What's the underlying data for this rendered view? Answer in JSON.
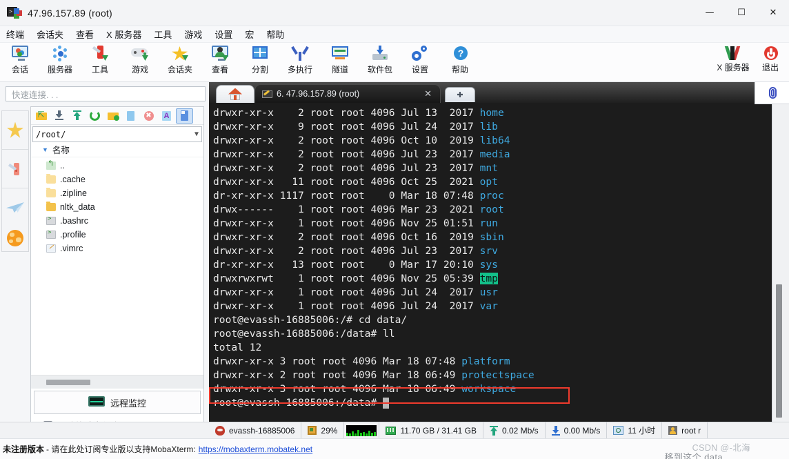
{
  "window": {
    "title": "47.96.157.89 (root)",
    "icon": "mobaxterm-icon",
    "controls": {
      "minimize": "—",
      "maximize": "☐",
      "close": "✕"
    }
  },
  "menubar": [
    {
      "label": "终端",
      "name": "menu-terminal"
    },
    {
      "label": "会话夹",
      "name": "menu-sessions-folder"
    },
    {
      "label": "查看",
      "name": "menu-view"
    },
    {
      "label": "X 服务器",
      "name": "menu-xserver"
    },
    {
      "label": "工具",
      "name": "menu-tools"
    },
    {
      "label": "游戏",
      "name": "menu-games"
    },
    {
      "label": "设置",
      "name": "menu-settings"
    },
    {
      "label": "宏",
      "name": "menu-macros"
    },
    {
      "label": "帮助",
      "name": "menu-help"
    }
  ],
  "toolbar": {
    "items": [
      {
        "label": "会话",
        "icon": "session-icon"
      },
      {
        "label": "服务器",
        "icon": "servers-icon"
      },
      {
        "label": "工具",
        "icon": "tools-icon"
      },
      {
        "label": "游戏",
        "icon": "games-icon"
      },
      {
        "label": "会话夹",
        "icon": "sessions-folder-icon"
      },
      {
        "label": "查看",
        "icon": "view-icon"
      },
      {
        "label": "分割",
        "icon": "split-icon"
      },
      {
        "label": "多执行",
        "icon": "multiexec-icon"
      },
      {
        "label": "隧道",
        "icon": "tunneling-icon"
      },
      {
        "label": "软件包",
        "icon": "packages-icon"
      },
      {
        "label": "设置",
        "icon": "settings-gear-icon"
      },
      {
        "label": "帮助",
        "icon": "help-icon"
      }
    ],
    "right_items": [
      {
        "label": "X 服务器",
        "icon": "xserver-icon"
      },
      {
        "label": "退出",
        "icon": "exit-icon"
      }
    ]
  },
  "quick_connect": {
    "placeholder": "快速连接. . ."
  },
  "rail": [
    {
      "name": "favorites",
      "icon": "star-icon"
    },
    {
      "name": "tools",
      "icon": "swiss-knife-icon"
    },
    {
      "name": "sftp",
      "icon": "paper-plane-icon"
    },
    {
      "name": "web",
      "icon": "globe-icon"
    }
  ],
  "file_browser": {
    "toolbar_icons": [
      "parent-folder-icon",
      "download-icon",
      "upload-icon",
      "refresh-icon",
      "new-folder-icon",
      "new-file-icon",
      "delete-icon",
      "text-format-icon",
      "sftp-mode-icon"
    ],
    "path": "/root/",
    "column_header": "名称",
    "sort_indicator": "▼",
    "entries": [
      {
        "name": "..",
        "type": "updir"
      },
      {
        "name": ".cache",
        "type": "folder-pale"
      },
      {
        "name": ".zipline",
        "type": "folder-pale"
      },
      {
        "name": "nltk_data",
        "type": "folder"
      },
      {
        "name": ".bashrc",
        "type": "shell-file"
      },
      {
        "name": ".profile",
        "type": "shell-file"
      },
      {
        "name": ".vimrc",
        "type": "text-file"
      }
    ],
    "monitor_button": "远程监控",
    "follow_checkbox": "跟踪终端文件夹",
    "follow_checked": false
  },
  "tabs": {
    "home_icon": "home-icon",
    "active": {
      "label": "6. 47.96.157.89 (root)",
      "icon": "key-icon",
      "close": "✕"
    },
    "new_tab": "✚"
  },
  "terminal": {
    "lines": [
      {
        "segments": [
          {
            "t": "drwxr-xr-x    2 root root 4096 Jul 13  2017 "
          },
          {
            "t": "home",
            "c": "dir"
          }
        ]
      },
      {
        "segments": [
          {
            "t": "drwxr-xr-x    9 root root 4096 Jul 24  2017 "
          },
          {
            "t": "lib",
            "c": "dir"
          }
        ]
      },
      {
        "segments": [
          {
            "t": "drwxr-xr-x    2 root root 4096 Oct 10  2019 "
          },
          {
            "t": "lib64",
            "c": "dir"
          }
        ]
      },
      {
        "segments": [
          {
            "t": "drwxr-xr-x    2 root root 4096 Jul 23  2017 "
          },
          {
            "t": "media",
            "c": "dir"
          }
        ]
      },
      {
        "segments": [
          {
            "t": "drwxr-xr-x    2 root root 4096 Jul 23  2017 "
          },
          {
            "t": "mnt",
            "c": "dir"
          }
        ]
      },
      {
        "segments": [
          {
            "t": "drwxr-xr-x   11 root root 4096 Oct 25  2021 "
          },
          {
            "t": "opt",
            "c": "dir"
          }
        ]
      },
      {
        "segments": [
          {
            "t": "dr-xr-xr-x 1117 root root    0 Mar 18 07:48 "
          },
          {
            "t": "proc",
            "c": "dir"
          }
        ]
      },
      {
        "segments": [
          {
            "t": "drwx------    1 root root 4096 Mar 23  2021 "
          },
          {
            "t": "root",
            "c": "dir"
          }
        ]
      },
      {
        "segments": [
          {
            "t": "drwxr-xr-x    1 root root 4096 Nov 25 01:51 "
          },
          {
            "t": "run",
            "c": "dir"
          }
        ]
      },
      {
        "segments": [
          {
            "t": "drwxr-xr-x    2 root root 4096 Oct 16  2019 "
          },
          {
            "t": "sbin",
            "c": "dir"
          }
        ]
      },
      {
        "segments": [
          {
            "t": "drwxr-xr-x    2 root root 4096 Jul 23  2017 "
          },
          {
            "t": "srv",
            "c": "dir"
          }
        ]
      },
      {
        "segments": [
          {
            "t": "dr-xr-xr-x   13 root root    0 Mar 17 20:10 "
          },
          {
            "t": "sys",
            "c": "dir"
          }
        ]
      },
      {
        "segments": [
          {
            "t": "drwxrwxrwt    1 root root 4096 Nov 25 05:39 "
          },
          {
            "t": "tmp",
            "c": "tmp"
          }
        ]
      },
      {
        "segments": [
          {
            "t": "drwxr-xr-x    1 root root 4096 Jul 24  2017 "
          },
          {
            "t": "usr",
            "c": "dir"
          }
        ]
      },
      {
        "segments": [
          {
            "t": "drwxr-xr-x    1 root root 4096 Jul 24  2017 "
          },
          {
            "t": "var",
            "c": "dir"
          }
        ]
      },
      {
        "segments": [
          {
            "t": "root@evassh-16885006:/# cd data/"
          }
        ]
      },
      {
        "segments": [
          {
            "t": "root@evassh-16885006:/data# ll"
          }
        ]
      },
      {
        "segments": [
          {
            "t": "total 12"
          }
        ]
      },
      {
        "segments": [
          {
            "t": "drwxr-xr-x 3 root root 4096 Mar 18 07:48 "
          },
          {
            "t": "platform",
            "c": "dir"
          }
        ]
      },
      {
        "segments": [
          {
            "t": "drwxr-xr-x 2 root root 4096 Mar 18 06:49 "
          },
          {
            "t": "protectspace",
            "c": "dir"
          }
        ]
      },
      {
        "segments": [
          {
            "t": "drwxr-xr-x 3 root root 4096 Mar 18 06:49 "
          },
          {
            "t": "workspace",
            "c": "dir"
          }
        ]
      },
      {
        "segments": [
          {
            "t": "root@evassh-16885006:/data# "
          },
          {
            "t": "█",
            "c": "cursor"
          }
        ]
      }
    ],
    "annotation": {
      "color": "#f03b2d",
      "target_line": "workspace"
    }
  },
  "status_bar": [
    {
      "icon": "linux-penguin-icon",
      "label": "evassh-16885006",
      "name": "status-host"
    },
    {
      "icon": "cpu-icon",
      "label": "29%",
      "name": "status-cpu"
    },
    {
      "icon": "cpu-graph",
      "label": "",
      "name": "status-cpu-graph"
    },
    {
      "icon": "memory-icon",
      "label": "11.70 GB / 31.41 GB",
      "name": "status-memory"
    },
    {
      "icon": "upload-arrow-icon",
      "label": "0.02 Mb/s",
      "name": "status-upload"
    },
    {
      "icon": "download-arrow-icon",
      "label": "0.00 Mb/s",
      "name": "status-download"
    },
    {
      "icon": "uptime-icon",
      "label": "11 小时",
      "name": "status-uptime"
    },
    {
      "icon": "user-icon",
      "label": "root  r",
      "name": "status-user"
    }
  ],
  "bottom_bar": {
    "unregistered": "未注册版本",
    "message": "- 请在此处订阅专业版以支持MobaXterm:",
    "link": "https://mobaxterm.mobatek.net"
  },
  "watermarks": {
    "csdn": "CSDN @-北海",
    "overlay": "移到这个 data"
  },
  "colors": {
    "accent": "#2f6fd0",
    "terminal_bg": "#1c1c1c",
    "terminal_fg": "#e8e8e8",
    "dir_color": "#3fa9e0",
    "tmp_bg": "#13c18a",
    "annotation": "#f03b2d",
    "link": "#1f4fd8"
  }
}
